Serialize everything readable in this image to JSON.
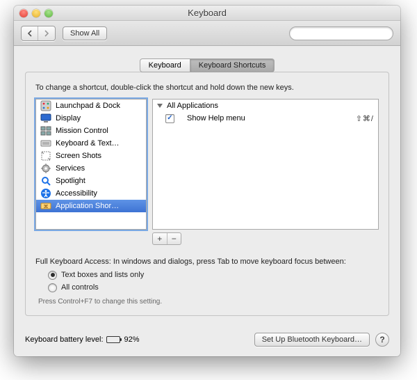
{
  "window": {
    "title": "Keyboard"
  },
  "toolbar": {
    "show_all": "Show All",
    "search_placeholder": ""
  },
  "tabs": {
    "keyboard": "Keyboard",
    "shortcuts": "Keyboard Shortcuts"
  },
  "pane": {
    "instruction": "To change a shortcut, double-click the shortcut and hold down the new keys.",
    "categories": [
      {
        "label": "Launchpad & Dock",
        "icon": "launchpad-icon"
      },
      {
        "label": "Display",
        "icon": "display-icon"
      },
      {
        "label": "Mission Control",
        "icon": "mission-control-icon"
      },
      {
        "label": "Keyboard & Text…",
        "icon": "keyboard-text-icon"
      },
      {
        "label": "Screen Shots",
        "icon": "screenshots-icon"
      },
      {
        "label": "Services",
        "icon": "services-icon"
      },
      {
        "label": "Spotlight",
        "icon": "spotlight-icon"
      },
      {
        "label": "Accessibility",
        "icon": "accessibility-icon"
      },
      {
        "label": "Application Shor…",
        "icon": "app-shortcuts-icon"
      }
    ],
    "selected_category_index": 8,
    "shortcuts_header": "All Applications",
    "shortcuts": [
      {
        "enabled": true,
        "label": "Show Help menu",
        "keys": "⇧⌘/"
      }
    ],
    "add_label": "+",
    "remove_label": "−"
  },
  "fka": {
    "intro": "Full Keyboard Access: In windows and dialogs, press Tab to move keyboard focus between:",
    "option_text_only": "Text boxes and lists only",
    "option_all": "All controls",
    "selected": "text",
    "hint": "Press Control+F7 to change this setting."
  },
  "footer": {
    "battery_label": "Keyboard battery level:",
    "battery_pct_text": "92%",
    "battery_pct": 92,
    "bluetooth_btn": "Set Up Bluetooth Keyboard…",
    "help": "?"
  }
}
